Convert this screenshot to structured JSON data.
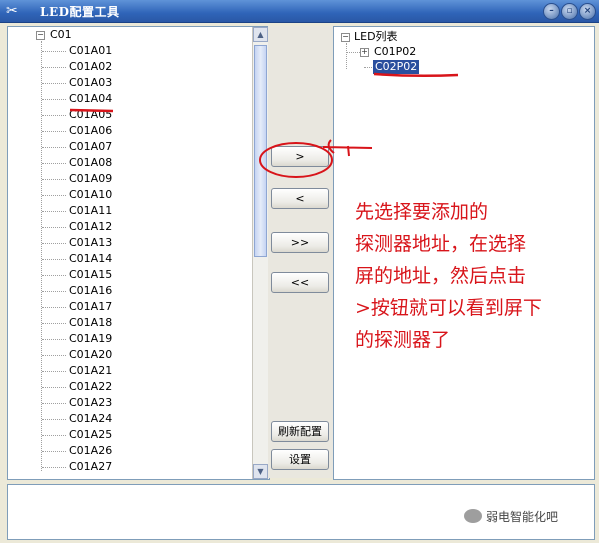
{
  "window": {
    "title": "LED配置工具",
    "min": "–",
    "restore": "▫",
    "close": "×"
  },
  "left_tree": {
    "root": "C01",
    "items": [
      "C01A01",
      "C01A02",
      "C01A03",
      "C01A04",
      "C01A05",
      "C01A06",
      "C01A07",
      "C01A08",
      "C01A09",
      "C01A10",
      "C01A11",
      "C01A12",
      "C01A13",
      "C01A14",
      "C01A15",
      "C01A16",
      "C01A17",
      "C01A18",
      "C01A19",
      "C01A20",
      "C01A21",
      "C01A22",
      "C01A23",
      "C01A24",
      "C01A25",
      "C01A26",
      "C01A27"
    ]
  },
  "buttons": {
    "add": ">",
    "remove": "<",
    "add_all": ">>",
    "remove_all": "<<",
    "refresh": "刷新配置",
    "settings": "设置"
  },
  "right_tree": {
    "root": "LED列表",
    "child1": "C01P02",
    "child2": "C02P02"
  },
  "annotation": {
    "lines": [
      "先选择要添加的",
      "探测器地址，在选择",
      "屏的地址，然后点击",
      ">按钮就可以看到屏下",
      "的探测器了"
    ]
  },
  "watermark": "弱电智能化吧",
  "colors": {
    "annotation": "#d8141a",
    "selection": "#2a4f9e",
    "titlebar": "#2f64b8"
  }
}
